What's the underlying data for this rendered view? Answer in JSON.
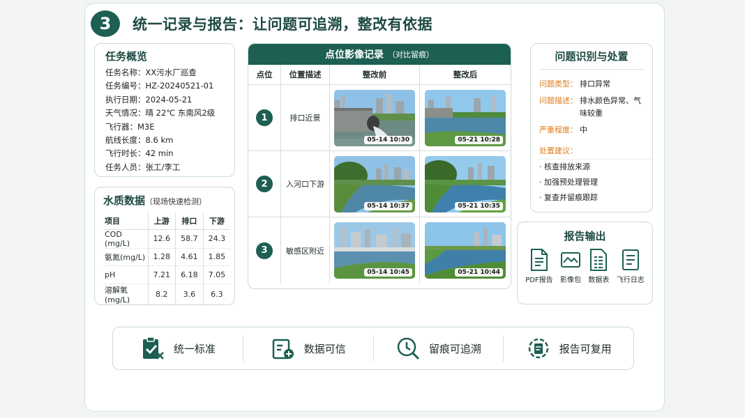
{
  "header": {
    "number": "3",
    "title": "统一记录与报告：让问题可追溯，整改有依据"
  },
  "task": {
    "title": "任务概览",
    "rows": [
      {
        "k": "任务名称：",
        "v": "XX污水厂巡查"
      },
      {
        "k": "任务编号：",
        "v": "HZ-20240521-01"
      },
      {
        "k": "执行日期：",
        "v": "2024-05-21"
      },
      {
        "k": "天气情况：",
        "v": "晴 22℃ 东南风2级"
      },
      {
        "k": "飞行器：",
        "v": "M3E"
      },
      {
        "k": "航线长度：",
        "v": "8.6 km"
      },
      {
        "k": "飞行时长：",
        "v": "42 min"
      },
      {
        "k": "任务人员：",
        "v": "张工/李工"
      }
    ]
  },
  "water": {
    "title": "水质数据",
    "subtitle": "（现场快速检测）",
    "headers": [
      "项目",
      "上游",
      "排口",
      "下游"
    ],
    "rows": [
      [
        "COD (mg/L)",
        "12.6",
        "58.7",
        "24.3"
      ],
      [
        "氨氮(mg/L)",
        "1.28",
        "4.61",
        "1.85"
      ],
      [
        "pH",
        "7.21",
        "6.18",
        "7.05"
      ],
      [
        "溶解氧(mg/L)",
        "8.2",
        "3.6",
        "6.3"
      ]
    ]
  },
  "record": {
    "title": "点位影像记录",
    "subtitle": "（对比留痕）",
    "headers": [
      "点位",
      "位置描述",
      "整改前",
      "整改后"
    ],
    "rows": [
      {
        "num": "1",
        "loc": "排口近景",
        "before": "05-14 10:30",
        "after": "05-21 10:28"
      },
      {
        "num": "2",
        "loc": "入河口下游",
        "before": "05-14 10:37",
        "after": "05-21 10:35"
      },
      {
        "num": "3",
        "loc": "敏感区附近",
        "before": "05-14 10:45",
        "after": "05-21 10:44"
      }
    ]
  },
  "issue": {
    "title": "问题识别与处置",
    "type_k": "问题类型：",
    "type_v": "排口异常",
    "desc_k": "问题描述：",
    "desc_v": "排水颜色异常、气味较重",
    "level_k": "严重程度：",
    "level_v": "中",
    "sugg_k": "处置建议：",
    "suggestions": [
      "· 核查排放来源",
      "· 加强预处理管理",
      "· 复查并留痕跟踪"
    ]
  },
  "report": {
    "title": "报告输出",
    "items": [
      {
        "label": "PDF报告",
        "icon": "pdf-doc-icon"
      },
      {
        "label": "影像包",
        "icon": "image-pack-icon"
      },
      {
        "label": "数据表",
        "icon": "data-sheet-icon"
      },
      {
        "label": "飞行日志",
        "icon": "flight-log-icon"
      }
    ]
  },
  "bar": {
    "items": [
      {
        "label": "统一标准",
        "icon": "clipboard-check-icon"
      },
      {
        "label": "数据可信",
        "icon": "data-shield-icon"
      },
      {
        "label": "留痕可追溯",
        "icon": "clock-search-icon"
      },
      {
        "label": "报告可复用",
        "icon": "report-cycle-icon"
      }
    ]
  },
  "colors": {
    "primary": "#1d5f52",
    "accent": "#e07a18",
    "border": "#c9dcd6"
  }
}
